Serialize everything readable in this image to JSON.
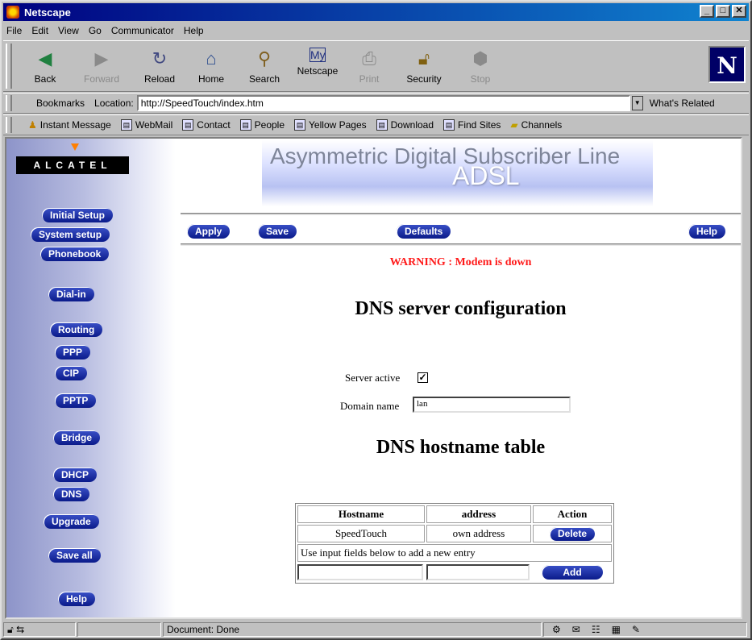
{
  "window": {
    "title": "Netscape"
  },
  "menu": [
    "File",
    "Edit",
    "View",
    "Go",
    "Communicator",
    "Help"
  ],
  "toolbar": [
    {
      "label": "Back",
      "icon": "back-arrow-icon",
      "enabled": true
    },
    {
      "label": "Forward",
      "icon": "forward-arrow-icon",
      "enabled": false
    },
    {
      "label": "Reload",
      "icon": "reload-icon",
      "enabled": true
    },
    {
      "label": "Home",
      "icon": "home-icon",
      "enabled": true
    },
    {
      "label": "Search",
      "icon": "search-icon",
      "enabled": true
    },
    {
      "label": "Netscape",
      "icon": "netscape-icon",
      "enabled": true
    },
    {
      "label": "Print",
      "icon": "print-icon",
      "enabled": false
    },
    {
      "label": "Security",
      "icon": "lock-icon",
      "enabled": true
    },
    {
      "label": "Stop",
      "icon": "stop-icon",
      "enabled": false
    }
  ],
  "location": {
    "bookmarks_label": "Bookmarks",
    "location_label": "Location:",
    "url": "http://SpeedTouch/index.htm",
    "related_label": "What's Related"
  },
  "personal": [
    "Instant Message",
    "WebMail",
    "Contact",
    "People",
    "Yellow Pages",
    "Download",
    "Find Sites",
    "Channels"
  ],
  "page": {
    "logo": "ALCATEL",
    "banner_line1": "Asymmetric Digital Subscriber Line",
    "banner_line2": "ADSL",
    "sidebar": [
      "Initial Setup",
      "System setup",
      "Phonebook",
      "Dial-in",
      "Routing",
      "PPP",
      "CIP",
      "PPTP",
      "Bridge",
      "DHCP",
      "DNS",
      "Upgrade",
      "Save all",
      "Help"
    ],
    "actions": {
      "apply": "Apply",
      "save": "Save",
      "defaults": "Defaults",
      "help": "Help"
    },
    "warning": "WARNING : Modem is down",
    "heading": "DNS server configuration",
    "server_active_label": "Server active",
    "server_active_checked": true,
    "domain_label": "Domain name",
    "domain_value": "lan",
    "table_heading": "DNS hostname table",
    "table": {
      "headers": [
        "Hostname",
        "address",
        "Action"
      ],
      "rows": [
        {
          "hostname": "SpeedTouch",
          "address": "own address",
          "action": "Delete"
        }
      ],
      "hint": "Use input fields below to add a new entry",
      "add_label": "Add"
    }
  },
  "status": {
    "text": "Document: Done"
  },
  "colors": {
    "warning": "#ff1a1a",
    "pill": "#1a2a9a"
  }
}
